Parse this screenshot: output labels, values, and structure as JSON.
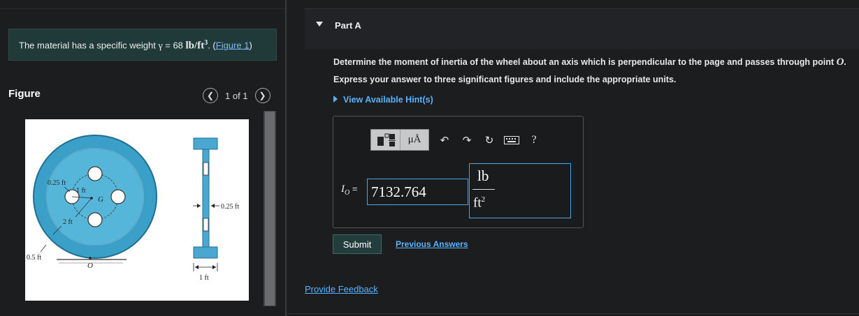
{
  "problem": {
    "text_before": "The material has a specific weight ",
    "gamma": "γ",
    "equals": " = 68 ",
    "unit": "lb/ft",
    "unit_exp": "3",
    "after_unit": ". (",
    "figure_link": "Figure 1",
    "close": ")"
  },
  "figure": {
    "label": "Figure",
    "pager_text": "1 of 1",
    "prev_icon": "chevron-left-icon",
    "next_icon": "chevron-right-icon",
    "labels": {
      "r_hole": "0.25 ft",
      "one_ft": "1 ft",
      "g": "G",
      "two_ft": "2 ft",
      "half_ft": "0.5 ft",
      "o": "O",
      "web_thickness": "0.25 ft",
      "width": "1 ft"
    },
    "colors": {
      "wheel": "#3aa0c8",
      "wheel_dark": "#1f6f93",
      "background": "#ffffff"
    }
  },
  "part": {
    "title": "Part A",
    "question_before": "Determine the moment of inertia of the wheel about an axis which is perpendicular to the page and passes through point ",
    "question_point": "O",
    "question_after": ".",
    "instruction": "Express your answer to three significant figures and include the appropriate units.",
    "hints_label": "View Available Hint(s)"
  },
  "answer": {
    "label_symbol": "I",
    "label_sub": "O",
    "label_eq": " = ",
    "value": "7132.764",
    "units_numerator": "lb",
    "units_denominator": "ft",
    "units_den_exp": "2",
    "toolbar": {
      "templates_icon": "templates-icon",
      "mu_a": "μÅ",
      "undo_icon": "undo-icon",
      "redo_icon": "redo-icon",
      "reset_icon": "reset-icon",
      "keyboard_icon": "keyboard-icon",
      "help": "?"
    }
  },
  "buttons": {
    "submit": "Submit",
    "previous_answers": "Previous Answers",
    "feedback": "Provide Feedback"
  }
}
